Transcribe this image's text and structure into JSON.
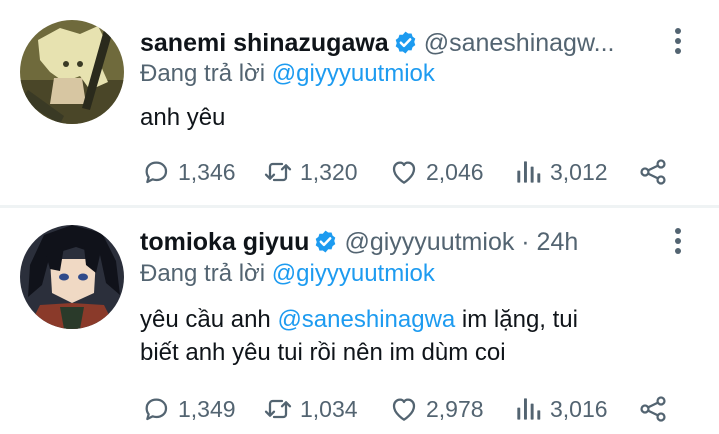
{
  "tweets": [
    {
      "name": "sanemi shinazugawa",
      "handle": "@saneshinagw...",
      "time": "",
      "replying_prefix": "Đang trả lời ",
      "replying_to": "@giyyyuutmiok",
      "text_parts": [
        "anh yêu"
      ],
      "replies": "1,346",
      "retweets": "1,320",
      "likes": "2,046",
      "views": "3,012",
      "avatar_colors": {
        "bg": "#6f6a3c",
        "hair": "#e7e2b0",
        "accent": "#3a3a25"
      }
    },
    {
      "name": "tomioka giyuu",
      "handle": "@giyyyuutmiok",
      "time": " · 24h",
      "replying_prefix": "Đang trả lời ",
      "replying_to": "@giyyyuutmiok",
      "text_parts": [
        "yêu cầu anh ",
        "@saneshinagwa",
        " im lặng, tui",
        "biết anh yêu tui rồi nên im dùm coi"
      ],
      "replies": "1,349",
      "retweets": "1,034",
      "likes": "2,978",
      "views": "3,016",
      "avatar_colors": {
        "bg": "#2b2f3b",
        "hair": "#10121a",
        "accent": "#8a3a2a"
      }
    }
  ],
  "icons": {
    "verified": "verified-badge-icon",
    "more": "more-vertical-icon",
    "reply": "reply-icon",
    "retweet": "retweet-icon",
    "like": "like-icon",
    "views": "views-icon",
    "share": "share-icon"
  },
  "colors": {
    "accent": "#1d9bf0",
    "muted": "#536471",
    "text": "#0f1419",
    "divider": "#eff3f4"
  }
}
